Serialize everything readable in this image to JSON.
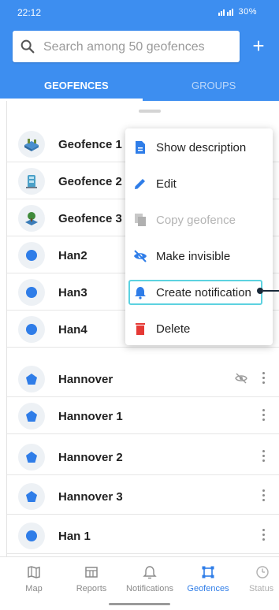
{
  "status_bar": {
    "time": "22:12",
    "indicators": "30%"
  },
  "search": {
    "placeholder": "Search among 50 geofences"
  },
  "add_button_label": "+",
  "tabs": [
    {
      "label": "GEOFENCES",
      "active": true
    },
    {
      "label": "GROUPS",
      "active": false
    }
  ],
  "geofences": [
    {
      "label": "Geofence 1",
      "icon": "tile-icon"
    },
    {
      "label": "Geofence 2",
      "icon": "building-icon"
    },
    {
      "label": "Geofence 3",
      "icon": "tree-icon"
    },
    {
      "label": "Han2",
      "icon": "circle-icon"
    },
    {
      "label": "Han3",
      "icon": "circle-icon"
    },
    {
      "label": "Han4",
      "icon": "circle-icon"
    },
    {
      "label": "Hannover",
      "icon": "polygon-icon",
      "hidden": true
    },
    {
      "label": "Hannover 1",
      "icon": "polygon-icon"
    },
    {
      "label": "Hannover 2",
      "icon": "polygon-icon"
    },
    {
      "label": "Hannover 3",
      "icon": "polygon-icon"
    },
    {
      "label": "Han 1",
      "icon": "circle-icon"
    }
  ],
  "context_menu": {
    "items": [
      {
        "label": "Show description",
        "icon": "document-icon",
        "enabled": true
      },
      {
        "label": "Edit",
        "icon": "pencil-icon",
        "enabled": true
      },
      {
        "label": "Copy geofence",
        "icon": "copy-icon",
        "enabled": false
      },
      {
        "label": "Make invisible",
        "icon": "eye-off-icon",
        "enabled": true
      },
      {
        "label": "Create notification",
        "icon": "bell-icon",
        "enabled": true,
        "highlighted": true
      },
      {
        "label": "Delete",
        "icon": "trash-icon",
        "enabled": true
      }
    ]
  },
  "bottom_nav": [
    {
      "label": "Map",
      "icon": "map-icon",
      "active": false
    },
    {
      "label": "Reports",
      "icon": "reports-icon",
      "active": false
    },
    {
      "label": "Notifications",
      "icon": "bell-icon",
      "active": false
    },
    {
      "label": "Geofences",
      "icon": "geofence-icon",
      "active": true
    },
    {
      "label": "Status",
      "icon": "status-icon",
      "active": false
    }
  ],
  "colors": {
    "primary": "#3d8ef0",
    "marker": "#2f7de8",
    "delete": "#e53935",
    "highlight": "#5cd2e0"
  }
}
